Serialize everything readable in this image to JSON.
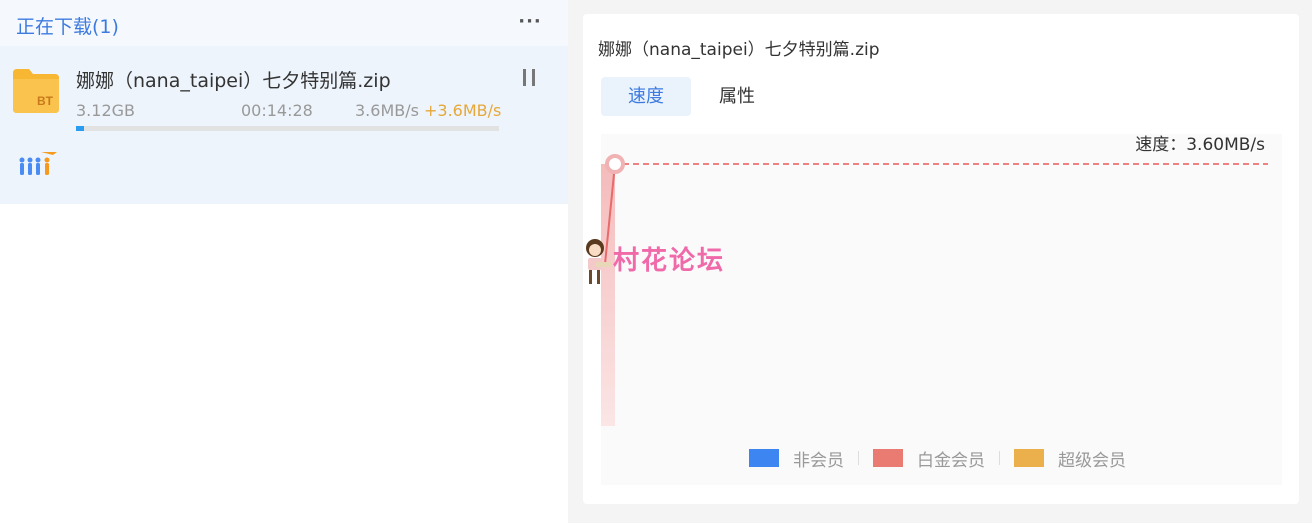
{
  "left_panel": {
    "title": "正在下载(1)",
    "more_label": "···"
  },
  "task": {
    "name": "娜娜（nana_taipei）七夕特别篇.zip",
    "icon_text": "BT",
    "size": "3.12GB",
    "time_left": "00:14:28",
    "speed": "3.6MB/s",
    "boost_speed": "+3.6MB/s",
    "progress_fraction": 0.02
  },
  "detail": {
    "title": "娜娜（nana_taipei）七夕特别篇.zip",
    "tabs": [
      {
        "label": "速度",
        "active": true
      },
      {
        "label": "属性",
        "active": false
      }
    ],
    "speed_readout": "速度：3.60MB/s",
    "legend": [
      {
        "label": "非会员",
        "color": "#3d86f2"
      },
      {
        "label": "白金会员",
        "color": "#e97b72"
      },
      {
        "label": "超级会员",
        "color": "#ebb04c"
      }
    ]
  },
  "watermark": {
    "text": "村花论坛"
  },
  "colors": {
    "accent": "#3d7be0",
    "speed_line": "#e85b5b",
    "boost": "#e6a83a"
  }
}
